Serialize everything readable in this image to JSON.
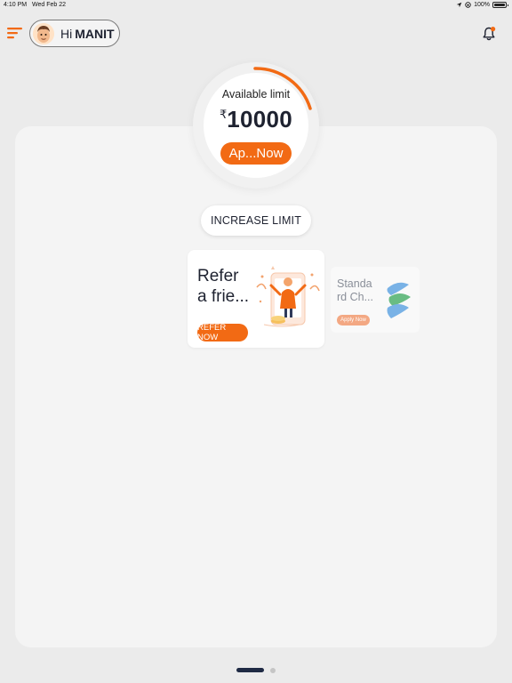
{
  "status_bar": {
    "time": "4:10 PM",
    "date": "Wed Feb 22",
    "battery": "100%"
  },
  "header": {
    "greeting": "Hi",
    "user_name": "MANIT",
    "avatar_icon": "memoji-avatar-icon",
    "menu_icon": "hamburger-menu-icon",
    "notification_icon": "bell-icon"
  },
  "limit": {
    "label": "Available limit",
    "currency": "₹",
    "amount": "10000",
    "apply_button": "Ap...Now"
  },
  "increase_limit_button": "INCREASE LIMIT",
  "cards": {
    "refer": {
      "title_line1": "Refer",
      "title_line2": "a frie...",
      "button": "REFER NOW"
    },
    "standard_chartered": {
      "title_line1": "Standa",
      "title_line2": "rd Ch...",
      "button": "Apply Now"
    }
  },
  "pagination": {
    "page_count": 2,
    "active_page": 1
  },
  "colors": {
    "accent": "#f26a14",
    "navy": "#1e2230",
    "background": "#ebebeb",
    "panel": "#f4f4f4"
  }
}
